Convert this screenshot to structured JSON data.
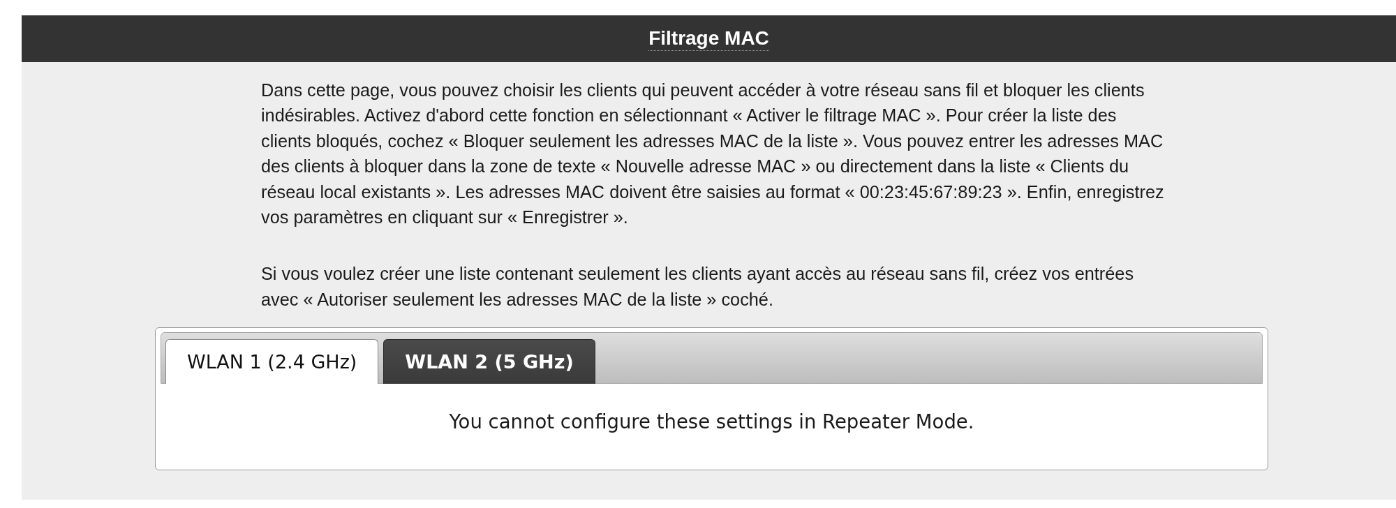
{
  "header": {
    "title": "Filtrage MAC"
  },
  "intro": {
    "paragraphs": [
      "Dans cette page, vous pouvez choisir les clients qui peuvent accéder à votre réseau sans fil et bloquer les clients indésirables. Activez d'abord cette fonction en sélectionnant « Activer le filtrage MAC ». Pour créer la liste des clients bloqués, cochez « Bloquer seulement les adresses MAC de la liste ». Vous pouvez entrer les adresses MAC des clients à bloquer dans la zone de texte « Nouvelle adresse MAC » ou directement dans la liste « Clients du réseau local existants ». Les adresses MAC doivent être saisies au format « 00:23:45:67:89:23 ». Enfin, enregistrez vos paramètres en cliquant sur « Enregistrer ».",
      "Si vous voulez créer une liste contenant seulement les clients ayant accès au réseau sans fil, créez vos entrées avec « Autoriser seulement les adresses MAC de la liste » coché."
    ]
  },
  "tabs": [
    {
      "label": "WLAN 1 (2.4 GHz)",
      "selected": true
    },
    {
      "label": "WLAN 2 (5 GHz)",
      "selected": false
    }
  ],
  "tab_content": {
    "message": "You cannot configure these settings in Repeater Mode."
  }
}
